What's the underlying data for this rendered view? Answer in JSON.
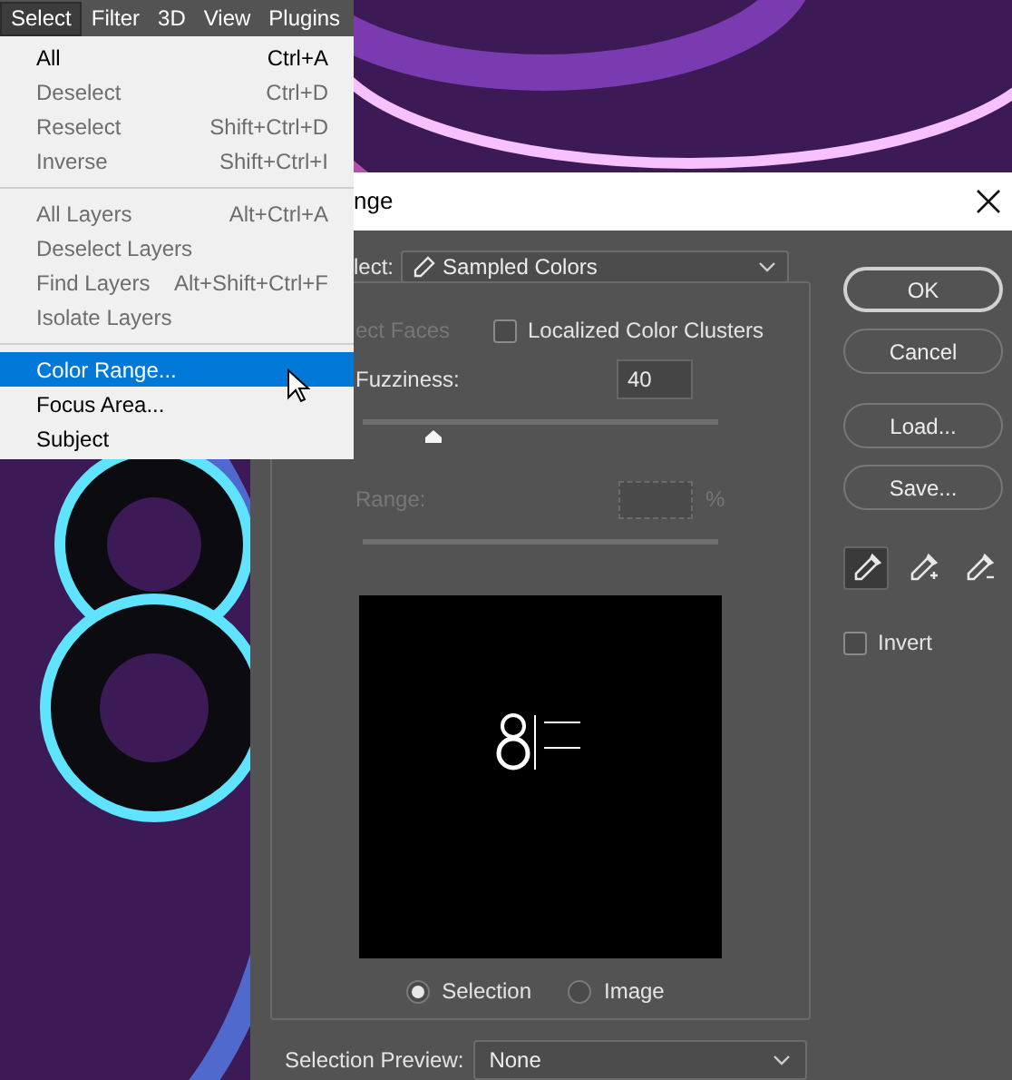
{
  "menu_bar": {
    "items": [
      {
        "label": "Select",
        "selected": true
      },
      {
        "label": "Filter",
        "selected": false
      },
      {
        "label": "3D",
        "selected": false
      },
      {
        "label": "View",
        "selected": false
      },
      {
        "label": "Plugins",
        "selected": false
      }
    ]
  },
  "menu": {
    "items": [
      {
        "kind": "item",
        "label": "All",
        "shortcut": "Ctrl+A",
        "disabled": false,
        "selected": false
      },
      {
        "kind": "item",
        "label": "Deselect",
        "shortcut": "Ctrl+D",
        "disabled": true,
        "selected": false
      },
      {
        "kind": "item",
        "label": "Reselect",
        "shortcut": "Shift+Ctrl+D",
        "disabled": true,
        "selected": false
      },
      {
        "kind": "item",
        "label": "Inverse",
        "shortcut": "Shift+Ctrl+I",
        "disabled": true,
        "selected": false
      },
      {
        "kind": "separator"
      },
      {
        "kind": "item",
        "label": "All Layers",
        "shortcut": "Alt+Ctrl+A",
        "disabled": true,
        "selected": false
      },
      {
        "kind": "item",
        "label": "Deselect Layers",
        "disabled": true,
        "selected": false
      },
      {
        "kind": "item",
        "label": "Find Layers",
        "shortcut": "Alt+Shift+Ctrl+F",
        "disabled": true,
        "selected": false
      },
      {
        "kind": "item",
        "label": "Isolate Layers",
        "disabled": true,
        "selected": false
      },
      {
        "kind": "separator"
      },
      {
        "kind": "item",
        "label": "Color Range...",
        "disabled": false,
        "selected": true
      },
      {
        "kind": "item",
        "label": "Focus Area...",
        "disabled": false,
        "selected": false
      },
      {
        "kind": "item",
        "label": "Subject",
        "disabled": false,
        "selected": false
      }
    ]
  },
  "dialog": {
    "title": "nge",
    "select": {
      "label": "lect:",
      "value": "Sampled Colors"
    },
    "detect_faces": {
      "label": "ect Faces",
      "disabled": true
    },
    "localized": {
      "label": "Localized Color Clusters",
      "checked": false
    },
    "fuzziness": {
      "label": "Fuzziness:",
      "value": "40",
      "level": 0.2
    },
    "range": {
      "label": "Range:",
      "unit": "%",
      "disabled": true
    },
    "view_options": [
      {
        "label": "Selection",
        "selected": true
      },
      {
        "label": "Image",
        "selected": false
      }
    ],
    "selection_preview": {
      "label": "Selection Preview:",
      "value": "None"
    },
    "buttons": [
      {
        "label": "OK",
        "default": true
      },
      {
        "label": "Cancel",
        "default": false
      },
      {
        "label": "Load...",
        "default": false
      },
      {
        "label": "Save...",
        "default": false
      }
    ],
    "eyedroppers": [
      {
        "kind": "sample",
        "selected": true
      },
      {
        "kind": "add",
        "selected": false
      },
      {
        "kind": "subtract",
        "selected": false
      }
    ],
    "invert": {
      "label": "Invert",
      "checked": false
    }
  }
}
